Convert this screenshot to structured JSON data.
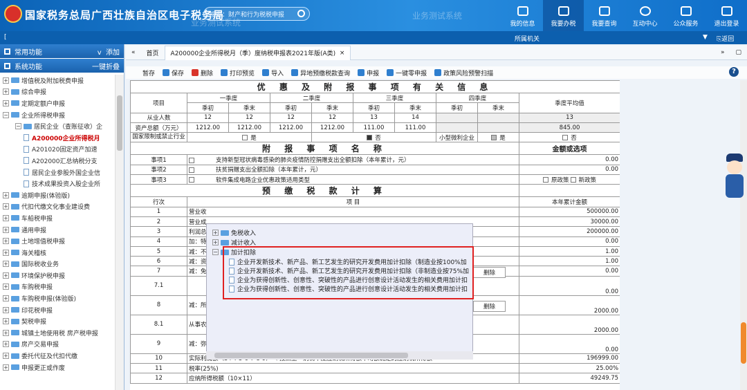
{
  "header": {
    "title": "国家税务总局广西壮族自治区电子税务局",
    "search_placeholder": "搜索：财产和行为税税申报",
    "watermark": "业务测试系统",
    "nav": [
      {
        "label": "我的信息"
      },
      {
        "label": "我要办税"
      },
      {
        "label": "我要查询"
      },
      {
        "label": "互动中心"
      },
      {
        "label": "公众服务"
      },
      {
        "label": "退出登录"
      }
    ],
    "org_label": "所属机关",
    "back_label": "返回"
  },
  "sidebar": {
    "common_label": "常用功能",
    "add_label": "添加",
    "system_label": "系统功能",
    "collapse_label": "一键折叠",
    "items": [
      {
        "label": "增值税及附加税费申报",
        "type": "folder"
      },
      {
        "label": "综合申报",
        "type": "folder"
      },
      {
        "label": "定期定额户申报",
        "type": "folder"
      },
      {
        "label": "企业所得税申报",
        "type": "folder-open"
      },
      {
        "label": "居民企业（查账征收）企",
        "type": "folder-open"
      },
      {
        "label": "A200000企业所得税月",
        "type": "doc",
        "selected": true
      },
      {
        "label": "A201020固定资产加速",
        "type": "doc"
      },
      {
        "label": "A202000汇总纳税分支",
        "type": "doc"
      },
      {
        "label": "居民企业参股外国企业信",
        "type": "doc"
      },
      {
        "label": "技术成果投资入股企业所",
        "type": "doc"
      },
      {
        "label": "逾期申报(体验版)",
        "type": "folder"
      },
      {
        "label": "代扣代缴文化事业建设费",
        "type": "folder"
      },
      {
        "label": "车船税申报",
        "type": "folder"
      },
      {
        "label": "通用申报",
        "type": "folder"
      },
      {
        "label": "土地增值税申报",
        "type": "folder"
      },
      {
        "label": "海关稽核",
        "type": "folder"
      },
      {
        "label": "国际税收业务",
        "type": "folder"
      },
      {
        "label": "环境保护税申报",
        "type": "folder"
      },
      {
        "label": "车购税申报",
        "type": "folder"
      },
      {
        "label": "车购税申报(体验版)",
        "type": "folder"
      },
      {
        "label": "印花税申报",
        "type": "folder"
      },
      {
        "label": "契税申报",
        "type": "folder"
      },
      {
        "label": "城镇土地使用税 房产税申报",
        "type": "folder"
      },
      {
        "label": "房产交易申报",
        "type": "folder"
      },
      {
        "label": "委托代征及代扣代缴",
        "type": "folder"
      },
      {
        "label": "申报更正或作废",
        "type": "folder"
      }
    ]
  },
  "tabs": {
    "home": "首页",
    "active": "A200000企业所得税月（季）度纳税申报表2021年版(A类)"
  },
  "toolbar": [
    {
      "label": "暂存"
    },
    {
      "label": "保存"
    },
    {
      "label": "删除"
    },
    {
      "label": "打印预览"
    },
    {
      "label": "导入"
    },
    {
      "label": "异地预缴税款查询"
    },
    {
      "label": "申报"
    },
    {
      "label": "一键零申报"
    },
    {
      "label": "政策风险预警扫描"
    }
  ],
  "form": {
    "sec1_title": "优 惠 及 附 报 事 项 有 关 信 息",
    "item_col": "项目",
    "quarters": [
      "一季度",
      "二季度",
      "三季度",
      "四季度"
    ],
    "q_begin": "季初",
    "q_end": "季末",
    "avg_col": "季度平均值",
    "emp_label": "从业人数",
    "emp": [
      "12",
      "12",
      "12",
      "12",
      "13",
      "14",
      "",
      ""
    ],
    "emp_avg": "13",
    "assets_label": "资产总额（万元）",
    "assets": [
      "1212.00",
      "1212.00",
      "1212.00",
      "1212.00",
      "111.00",
      "111.00",
      "",
      ""
    ],
    "assets_avg": "845.00",
    "restrict_label": "国家限制或禁止行业",
    "yes": "是",
    "no": "否",
    "small_label": "小型微利企业",
    "sec2_title": "附 报 事 项 名 称",
    "amount_col": "金额或选项",
    "attach": [
      {
        "name": "事项1",
        "desc": "支持新型冠状病毒感染的肺炎疫情防控捐赠支出全额扣除（本年累计，元）",
        "value": "0.00"
      },
      {
        "name": "事项2",
        "desc": "扶贫捐赠支出全额扣除（本年累计，元）",
        "value": "0.00"
      },
      {
        "name": "事项3",
        "desc": "软件集成电路企业优惠政策适用类型",
        "opt1": "原政策",
        "opt2": "新政策"
      }
    ],
    "sec3_title": "预 缴 税 款 计 算",
    "row_col": "行次",
    "proj_col": "项 目",
    "cum_col": "本年累计金额",
    "delete_label": "删除",
    "rows": [
      {
        "no": "1",
        "label": "营业收",
        "value": "500000.00"
      },
      {
        "no": "2",
        "label": "营业成",
        "value": "30000.00"
      },
      {
        "no": "3",
        "label": "利润总",
        "value": "200000.00"
      },
      {
        "no": "4",
        "label": "加：特",
        "value": "0.00"
      },
      {
        "no": "5",
        "label": "减：不",
        "value": "1.00"
      },
      {
        "no": "6",
        "label": "减：资",
        "value": "1.00"
      },
      {
        "no": "7",
        "label": "减：免",
        "value": "0.00"
      },
      {
        "no": "7.1",
        "label": "",
        "value": "0.00"
      },
      {
        "no": "8",
        "label": "减：所",
        "value": "2000.00"
      },
      {
        "no": "8.1",
        "label": "从事农",
        "value": "2000.00"
      },
      {
        "no": "9",
        "label": "减：弥",
        "value": "0.00"
      },
      {
        "no": "10",
        "label": "实际利润额（3+4-5-6-7-8-9）＼ 按照上一纳税年度应纳税所得额平均额确定的应纳税所得额",
        "value": "196999.00"
      },
      {
        "no": "11",
        "label": "税率(25%)",
        "value": "25.00%"
      },
      {
        "no": "12",
        "label": "应纳所得税额（10×11）",
        "value": "49249.75"
      }
    ]
  },
  "popup": {
    "items": [
      {
        "label": "免税收入"
      },
      {
        "label": "减计收入"
      },
      {
        "label": "加计扣除"
      },
      {
        "label": "企业开发新技术、新产品、新工艺发生的研究开发费用加计扣除（制造业按100%加"
      },
      {
        "label": "企业开发新技术、新产品、新工艺发生的研究开发费用加计扣除（非制造业按75%加"
      },
      {
        "label": "企业为获得创新性、创意性、突破性的产品进行创意设计活动发生的相关费用加计扣"
      },
      {
        "label": "企业为获得创新性、创意性、突破性的产品进行创意设计活动发生的相关费用加计扣"
      }
    ]
  },
  "colors": {
    "header_blue": "#1a73c8",
    "highlight_red": "#e02020",
    "selected_text": "#cc0000"
  }
}
